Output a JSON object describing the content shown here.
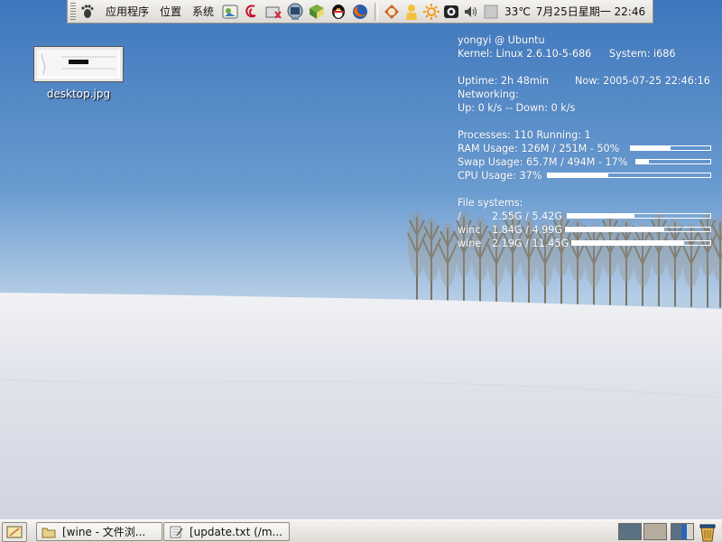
{
  "colors": {
    "sky_top": "#3f79bf",
    "sky_bottom": "#b6cfe6",
    "snow": "#e9eaf0",
    "panel_bg": "#e6e3de",
    "workspace_active": "#5a7083",
    "workspace_inactive": "#b6ac9e"
  },
  "top_panel": {
    "foot_icon": "gnome-foot-icon",
    "menus": [
      "应用程序",
      "位置",
      "系统"
    ],
    "launchers": [
      {
        "icon": "image-viewer-icon"
      },
      {
        "icon": "debian-swirl-icon"
      },
      {
        "icon": "screenshot-tool-icon"
      },
      {
        "icon": "terminal-monitor-icon"
      },
      {
        "icon": "dictionary-book-icon"
      },
      {
        "icon": "qq-penguin-icon"
      },
      {
        "icon": "firefox-icon"
      }
    ],
    "tray": [
      {
        "icon": "update-manager-icon"
      },
      {
        "icon": "user-icon"
      },
      {
        "icon": "sun-settings-icon"
      },
      {
        "icon": "webcam-icon"
      },
      {
        "icon": "volume-icon"
      },
      {
        "icon": "weather-icon"
      }
    ],
    "weather_text": "33℃",
    "clock_text": "7月25日星期一 22:46"
  },
  "desktop": {
    "icons": [
      {
        "label": "desktop.jpg",
        "icon": "image-file-icon"
      }
    ]
  },
  "conky": {
    "user_host": "yongyi @ Ubuntu",
    "kernel": "Kernel: Linux 2.6.10-5-686",
    "system": "System: i686",
    "uptime": "Uptime:  2h 48min",
    "now": "Now: 2005-07-25 22:46:16",
    "networking_label": "Networking:",
    "net_speeds": " Up: 0 k/s -- Down: 0 k/s",
    "processes": "Processes: 110  Running: 1",
    "ram_text": "RAM Usage: 126M / 251M - 50%",
    "ram_pct": 0.5,
    "swap_text": "Swap Usage: 65.7M / 494M - 17%",
    "swap_pct": 0.17,
    "cpu_text": "CPU Usage: 37%",
    "cpu_pct": 0.37,
    "fs_label": "File systems:",
    "filesystems": [
      {
        "name": "  /",
        "usage": "2.55G / 5.42G",
        "pct": 0.47
      },
      {
        "name": " winc",
        "usage": "1.84G / 4.99G",
        "pct": 0.68
      },
      {
        "name": " wine",
        "usage": "2.19G / 11.45G",
        "pct": 0.81
      }
    ]
  },
  "bottom_panel": {
    "show_desktop_icon": "show-desktop-icon",
    "tasks": [
      {
        "label": "[wine - 文件浏...",
        "icon": "folder-icon"
      },
      {
        "label": "[update.txt (/m...",
        "icon": "text-editor-icon"
      }
    ],
    "workspaces": 2,
    "trash_icon": "trash-icon"
  }
}
